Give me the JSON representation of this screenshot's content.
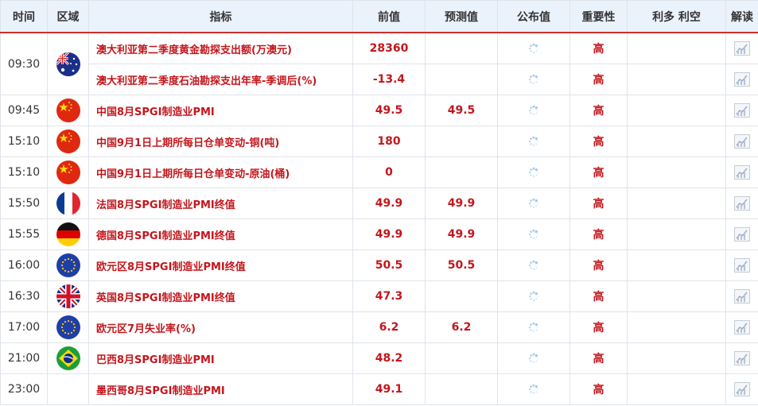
{
  "header": {
    "time": "时间",
    "region": "区域",
    "indicator": "指标",
    "previous": "前值",
    "forecast": "预测值",
    "actual": "公布值",
    "importance": "重要性",
    "impact": "利多 利空",
    "analysis": "解读"
  },
  "rows": [
    {
      "time": "09:30",
      "flag": "australia",
      "indicator": "澳大利亚第二季度黄金勘探支出额(万澳元)",
      "previous": "28360",
      "forecast": "",
      "importance": "高"
    },
    {
      "time": "",
      "flag": "",
      "indicator": "澳大利亚第二季度石油勘探支出年率-季调后(%)",
      "previous": "-13.4",
      "forecast": "",
      "importance": "高"
    },
    {
      "time": "09:45",
      "flag": "china",
      "indicator": "中国8月SPGI制造业PMI",
      "previous": "49.5",
      "forecast": "49.5",
      "importance": "高"
    },
    {
      "time": "15:10",
      "flag": "china",
      "indicator": "中国9月1日上期所每日仓单变动-铜(吨)",
      "previous": "180",
      "forecast": "",
      "importance": "高"
    },
    {
      "time": "15:10",
      "flag": "china",
      "indicator": "中国9月1日上期所每日仓单变动-原油(桶)",
      "previous": "0",
      "forecast": "",
      "importance": "高"
    },
    {
      "time": "15:50",
      "flag": "france",
      "indicator": "法国8月SPGI制造业PMI终值",
      "previous": "49.9",
      "forecast": "49.9",
      "importance": "高"
    },
    {
      "time": "15:55",
      "flag": "germany",
      "indicator": "德国8月SPGI制造业PMI终值",
      "previous": "49.9",
      "forecast": "49.9",
      "importance": "高"
    },
    {
      "time": "16:00",
      "flag": "eu",
      "indicator": "欧元区8月SPGI制造业PMI终值",
      "previous": "50.5",
      "forecast": "50.5",
      "importance": "高"
    },
    {
      "time": "16:30",
      "flag": "uk",
      "indicator": "英国8月SPGI制造业PMI终值",
      "previous": "47.3",
      "forecast": "",
      "importance": "高"
    },
    {
      "time": "17:00",
      "flag": "eu",
      "indicator": "欧元区7月失业率(%)",
      "previous": "6.2",
      "forecast": "6.2",
      "importance": "高"
    },
    {
      "time": "21:00",
      "flag": "brazil",
      "indicator": "巴西8月SPGI制造业PMI",
      "previous": "48.2",
      "forecast": "",
      "importance": "高"
    },
    {
      "time": "23:00",
      "flag": "",
      "indicator": "墨西哥8月SPGI制造业PMI",
      "previous": "49.1",
      "forecast": "",
      "importance": "高"
    }
  ],
  "icons": {
    "actual": "loading-spinner-icon",
    "analysis": "line-chart-icon"
  },
  "colors": {
    "header_bg": "#eaf2fb",
    "accent_red": "#c4161c",
    "header_border": "#c9302c",
    "grid": "#dfe3ea"
  }
}
